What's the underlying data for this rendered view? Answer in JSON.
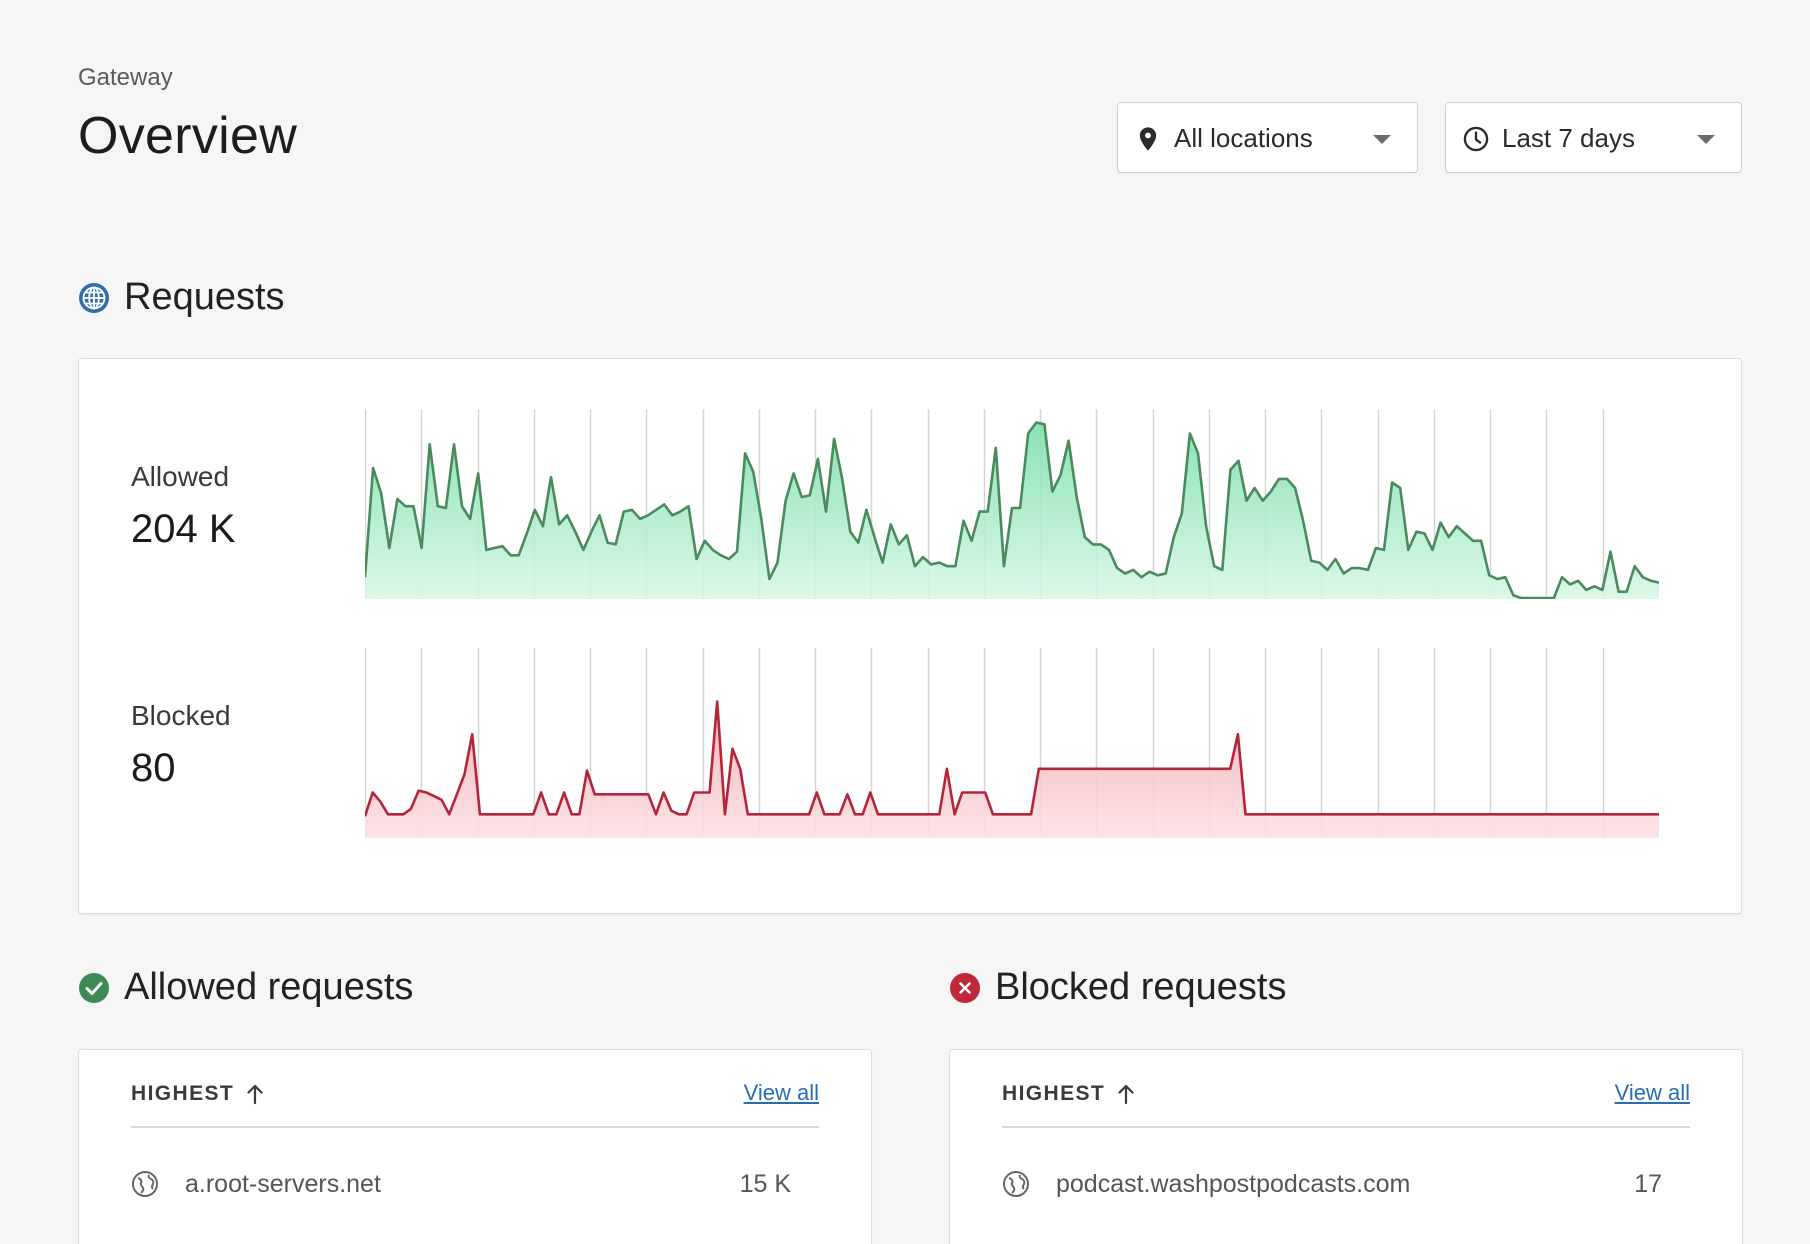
{
  "header": {
    "breadcrumb": "Gateway",
    "title": "Overview"
  },
  "filters": {
    "location": {
      "icon": "map-pin-icon",
      "label": "All locations"
    },
    "time_range": {
      "icon": "clock-icon",
      "label": "Last 7 days"
    }
  },
  "requests_section": {
    "icon": "globe-icon",
    "title": "Requests"
  },
  "metrics": {
    "allowed": {
      "label": "Allowed",
      "value": "204 K"
    },
    "blocked": {
      "label": "Blocked",
      "value": "80"
    }
  },
  "chart_data": [
    {
      "type": "area",
      "series": [
        {
          "values": [
            12,
            72,
            58,
            28,
            55,
            51,
            51,
            28,
            85,
            51,
            50,
            85,
            51,
            44,
            69,
            27,
            28,
            29,
            24,
            24,
            36,
            49,
            40,
            67,
            41,
            46,
            37,
            27,
            37,
            46,
            31,
            30,
            48,
            49,
            44,
            46,
            49,
            52,
            46,
            48,
            51,
            22,
            32,
            27,
            24,
            22,
            26,
            80,
            70,
            44,
            11,
            20,
            54,
            69,
            56,
            57,
            77,
            48,
            88,
            66,
            37,
            31,
            49,
            34,
            20,
            41,
            30,
            35,
            18,
            23,
            19,
            20,
            18,
            18,
            43,
            32,
            48,
            48,
            83,
            18,
            50,
            50,
            91,
            97,
            96,
            59,
            68,
            87,
            56,
            34,
            30,
            30,
            27,
            17,
            14,
            16,
            12,
            15,
            13,
            14,
            34,
            47,
            91,
            80,
            40,
            18,
            16,
            71,
            76,
            54,
            61,
            54,
            59,
            66,
            66,
            61,
            43,
            21,
            20,
            16,
            22,
            14,
            17,
            17,
            16,
            28,
            27,
            64,
            61,
            27,
            37,
            36,
            27,
            42,
            34,
            40,
            36,
            32,
            32,
            13,
            11,
            12,
            2,
            0.5,
            0.5,
            0.5,
            0.5,
            0.5,
            12,
            8,
            10,
            5,
            7,
            5,
            26,
            4,
            4,
            18,
            12,
            10,
            9
          ]
        }
      ]
    },
    {
      "type": "area",
      "series": [
        {
          "values": [
            12,
            25,
            20,
            13,
            13,
            13,
            16,
            26,
            25,
            23,
            21,
            13,
            24,
            35,
            57,
            13,
            13,
            13,
            13,
            13,
            13,
            13,
            13,
            25,
            13,
            13,
            25,
            13,
            13,
            37,
            24,
            24,
            24,
            24,
            24,
            24,
            24,
            24,
            13,
            25,
            15,
            13,
            13,
            25,
            25,
            25,
            75,
            13,
            49,
            38,
            13,
            13,
            13,
            13,
            13,
            13,
            13,
            13,
            13,
            25,
            13,
            13,
            13,
            24,
            13,
            13,
            25,
            13,
            13,
            13,
            13,
            13,
            13,
            13,
            13,
            13,
            38,
            13,
            25,
            25,
            25,
            25,
            13,
            13,
            13,
            13,
            13,
            13,
            38,
            38,
            38,
            38,
            38,
            38,
            38,
            38,
            38,
            38,
            38,
            38,
            38,
            38,
            38,
            38,
            38,
            38,
            38,
            38,
            38,
            38,
            38,
            38,
            38,
            38,
            57,
            13,
            13,
            13,
            13,
            13,
            13,
            13,
            13,
            13,
            13,
            13,
            13,
            13,
            13,
            13,
            13,
            13,
            13,
            13,
            13,
            13,
            13,
            13,
            13,
            13,
            13,
            13,
            13,
            13,
            13,
            13,
            13,
            13,
            13,
            13,
            13,
            13,
            13,
            13,
            13,
            13,
            13,
            13,
            13,
            13,
            13,
            13,
            13,
            13,
            13,
            13,
            13,
            13,
            13,
            13
          ]
        }
      ]
    }
  ],
  "allowed_section": {
    "icon": "check-circle-icon",
    "title": "Allowed requests",
    "sort_label": "HIGHEST",
    "view_all": "View all",
    "rows": [
      {
        "icon": "globe-icon",
        "name": "a.root-servers.net",
        "count": "15 K"
      }
    ]
  },
  "blocked_section": {
    "icon": "x-circle-icon",
    "title": "Blocked requests",
    "sort_label": "HIGHEST",
    "view_all": "View all",
    "rows": [
      {
        "icon": "globe-icon",
        "name": "podcast.washpostpodcasts.com",
        "count": "17"
      }
    ]
  },
  "colors": {
    "allowed_line": "#4a8a5c",
    "allowed_fill": "#8fe3b8",
    "blocked_line": "#b5253a",
    "blocked_fill": "#f6c7cb",
    "link": "#2a6db5",
    "allowed_icon": "#3e8a55",
    "blocked_icon": "#c0283a"
  }
}
